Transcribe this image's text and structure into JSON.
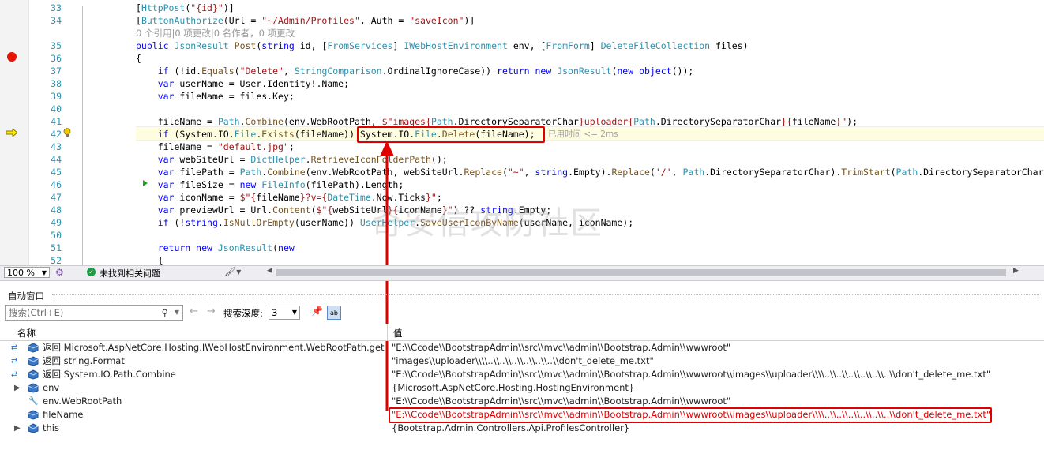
{
  "editor": {
    "lines": [
      {
        "n": "33",
        "parts": [
          [
            "p",
            "["
          ],
          [
            "at",
            "HttpPost"
          ],
          [
            "p",
            "("
          ],
          [
            "st",
            "\"{id}\""
          ],
          [
            "p",
            ")]"
          ]
        ]
      },
      {
        "n": "34",
        "parts": [
          [
            "p",
            "["
          ],
          [
            "at",
            "ButtonAuthorize"
          ],
          [
            "p",
            "(Url = "
          ],
          [
            "st",
            "\"~/Admin/Profiles\""
          ],
          [
            "p",
            ", Auth = "
          ],
          [
            "st",
            "\"saveIcon\""
          ],
          [
            "p",
            ")]"
          ]
        ]
      },
      {
        "n": "",
        "codelens": "0 个引用|0 项更改|0 名作者，0 项更改"
      },
      {
        "n": "35",
        "parts": [
          [
            "kw",
            "public "
          ],
          [
            "ty",
            "JsonResult "
          ],
          [
            "fn",
            "Post"
          ],
          [
            "p",
            "("
          ],
          [
            "kw",
            "string"
          ],
          [
            "p",
            " id, ["
          ],
          [
            "ty",
            "FromServices"
          ],
          [
            "p",
            "] "
          ],
          [
            "ty",
            "IWebHostEnvironment"
          ],
          [
            "p",
            " env, ["
          ],
          [
            "ty",
            "FromForm"
          ],
          [
            "p",
            "] "
          ],
          [
            "ty",
            "DeleteFileCollection"
          ],
          [
            "p",
            " files)"
          ]
        ]
      },
      {
        "n": "36",
        "parts": [
          [
            "p",
            "{"
          ]
        ]
      },
      {
        "n": "37",
        "parts": [
          [
            "kw",
            "    if "
          ],
          [
            "p",
            "(!id."
          ],
          [
            "fn",
            "Equals"
          ],
          [
            "p",
            "("
          ],
          [
            "st",
            "\"Delete\""
          ],
          [
            "p",
            ", "
          ],
          [
            "ty",
            "StringComparison"
          ],
          [
            "p",
            ".OrdinalIgnoreCase)) "
          ],
          [
            "kw",
            "return new "
          ],
          [
            "ty",
            "JsonResult"
          ],
          [
            "p",
            "("
          ],
          [
            "kw",
            "new object"
          ],
          [
            "p",
            "());"
          ]
        ]
      },
      {
        "n": "38",
        "parts": [
          [
            "kw",
            "    var "
          ],
          [
            "p",
            "userName = User.Identity!.Name;"
          ]
        ]
      },
      {
        "n": "39",
        "parts": [
          [
            "kw",
            "    var "
          ],
          [
            "p",
            "fileName = files.Key;"
          ]
        ]
      },
      {
        "n": "40",
        "parts": []
      },
      {
        "n": "41",
        "parts": [
          [
            "p",
            "    fileName = "
          ],
          [
            "ty",
            "Path"
          ],
          [
            "p",
            "."
          ],
          [
            "fn",
            "Combine"
          ],
          [
            "p",
            "(env.WebRootPath, "
          ],
          [
            "st",
            "$\"images{"
          ],
          [
            "ty",
            "Path"
          ],
          [
            "p",
            ".DirectorySeparatorChar"
          ],
          [
            "st",
            "}uploader{"
          ],
          [
            "ty",
            "Path"
          ],
          [
            "p",
            ".DirectorySeparatorChar"
          ],
          [
            "st",
            "}{"
          ],
          [
            "p",
            "fileName"
          ],
          [
            "st",
            "}\""
          ],
          [
            "p",
            ");"
          ]
        ]
      },
      {
        "n": "42",
        "parts": [
          [
            "kw",
            "    if "
          ],
          [
            "p",
            "(System.IO."
          ],
          [
            "ty",
            "File"
          ],
          [
            "p",
            "."
          ],
          [
            "fn",
            "Exists"
          ],
          [
            "p",
            "(fileName)) System.IO."
          ],
          [
            "ty",
            "File"
          ],
          [
            "p",
            "."
          ],
          [
            "fn",
            "Delete"
          ],
          [
            "p",
            "(fileName);"
          ]
        ]
      },
      {
        "n": "43",
        "parts": [
          [
            "p",
            "    fileName = "
          ],
          [
            "st",
            "\"default.jpg\""
          ],
          [
            "p",
            ";"
          ]
        ]
      },
      {
        "n": "44",
        "parts": [
          [
            "kw",
            "    var "
          ],
          [
            "p",
            "webSiteUrl = "
          ],
          [
            "ty",
            "DictHelper"
          ],
          [
            "p",
            "."
          ],
          [
            "fn",
            "RetrieveIconFolderPath"
          ],
          [
            "p",
            "();"
          ]
        ]
      },
      {
        "n": "45",
        "parts": [
          [
            "kw",
            "    var "
          ],
          [
            "p",
            "filePath = "
          ],
          [
            "ty",
            "Path"
          ],
          [
            "p",
            "."
          ],
          [
            "fn",
            "Combine"
          ],
          [
            "p",
            "(env.WebRootPath, webSiteUrl."
          ],
          [
            "fn",
            "Replace"
          ],
          [
            "p",
            "("
          ],
          [
            "st",
            "\"~\""
          ],
          [
            "p",
            ", "
          ],
          [
            "kw",
            "string"
          ],
          [
            "p",
            ".Empty)."
          ],
          [
            "fn",
            "Replace"
          ],
          [
            "p",
            "("
          ],
          [
            "st",
            "'/'"
          ],
          [
            "p",
            ", "
          ],
          [
            "ty",
            "Path"
          ],
          [
            "p",
            ".DirectorySeparatorChar)."
          ],
          [
            "fn",
            "TrimStart"
          ],
          [
            "p",
            "("
          ],
          [
            "ty",
            "Path"
          ],
          [
            "p",
            ".DirectorySeparatorChar"
          ]
        ]
      },
      {
        "n": "46",
        "parts": [
          [
            "kw",
            "    var "
          ],
          [
            "p",
            "fileSize = "
          ],
          [
            "kw",
            "new "
          ],
          [
            "ty",
            "FileInfo"
          ],
          [
            "p",
            "(filePath).Length;"
          ]
        ]
      },
      {
        "n": "47",
        "parts": [
          [
            "kw",
            "    var "
          ],
          [
            "p",
            "iconName = "
          ],
          [
            "st",
            "$\"{"
          ],
          [
            "p",
            "fileName"
          ],
          [
            "st",
            "}?v={"
          ],
          [
            "ty",
            "DateTime"
          ],
          [
            "p",
            ".Now.Ticks"
          ],
          [
            "st",
            "}\""
          ],
          [
            "p",
            ";"
          ]
        ]
      },
      {
        "n": "48",
        "parts": [
          [
            "kw",
            "    var "
          ],
          [
            "p",
            "previewUrl = Url."
          ],
          [
            "fn",
            "Content"
          ],
          [
            "p",
            "("
          ],
          [
            "st",
            "$\"{"
          ],
          [
            "p",
            "webSiteUrl"
          ],
          [
            "st",
            "}{"
          ],
          [
            "p",
            "iconName"
          ],
          [
            "st",
            "}\""
          ],
          [
            "p",
            ") ?? "
          ],
          [
            "kw",
            "string"
          ],
          [
            "p",
            ".Empty;"
          ]
        ]
      },
      {
        "n": "49",
        "parts": [
          [
            "kw",
            "    if "
          ],
          [
            "p",
            "(!"
          ],
          [
            "kw",
            "string"
          ],
          [
            "p",
            "."
          ],
          [
            "fn",
            "IsNullOrEmpty"
          ],
          [
            "p",
            "(userName)) "
          ],
          [
            "ty",
            "UserHelper"
          ],
          [
            "p",
            "."
          ],
          [
            "fn",
            "SaveUserIconByName"
          ],
          [
            "p",
            "(userName, iconName);"
          ]
        ]
      },
      {
        "n": "50",
        "parts": []
      },
      {
        "n": "51",
        "parts": [
          [
            "kw",
            "    return new "
          ],
          [
            "ty",
            "JsonResult"
          ],
          [
            "p",
            "("
          ],
          [
            "kw",
            "new"
          ]
        ]
      },
      {
        "n": "52",
        "parts": [
          [
            "p",
            "    {"
          ]
        ]
      }
    ],
    "elapsed_hint": "已用时间 <= 2ms",
    "watermark": "奇安信攻防社区"
  },
  "statusstrip": {
    "zoom": "100 %",
    "issues": "未找到相关问题"
  },
  "autos": {
    "title": "自动窗口",
    "search_placeholder": "搜索(Ctrl+E)",
    "depth_label": "搜索深度:",
    "depth_value": "3",
    "col_name": "名称",
    "col_value": "值",
    "rows": [
      {
        "kind": "ret",
        "name": "返回 Microsoft.AspNetCore.Hosting.IWebHostEnvironment.WebRootPath.get",
        "value": "\"E:\\\\Ccode\\\\BootstrapAdmin\\\\src\\\\mvc\\\\admin\\\\Bootstrap.Admin\\\\wwwroot\""
      },
      {
        "kind": "ret",
        "name": "返回 string.Format",
        "value": "\"images\\\\uploader\\\\\\\\..\\\\..\\\\..\\\\..\\\\..\\\\..\\\\don't_delete_me.txt\""
      },
      {
        "kind": "ret",
        "name": "返回 System.IO.Path.Combine",
        "value": "\"E:\\\\Ccode\\\\BootstrapAdmin\\\\src\\\\mvc\\\\admin\\\\Bootstrap.Admin\\\\wwwroot\\\\images\\\\uploader\\\\\\\\..\\\\..\\\\..\\\\..\\\\..\\\\..\\\\don't_delete_me.txt\""
      },
      {
        "kind": "exp",
        "name": "env",
        "value": "{Microsoft.AspNetCore.Hosting.HostingEnvironment}"
      },
      {
        "kind": "wrench",
        "name": "env.WebRootPath",
        "value": "\"E:\\\\Ccode\\\\BootstrapAdmin\\\\src\\\\mvc\\\\admin\\\\Bootstrap.Admin\\\\wwwroot\""
      },
      {
        "kind": "plain",
        "name": "fileName",
        "value": "\"E:\\\\Ccode\\\\BootstrapAdmin\\\\src\\\\mvc\\\\admin\\\\Bootstrap.Admin\\\\wwwroot\\\\images\\\\uploader\\\\\\\\..\\\\..\\\\..\\\\..\\\\..\\\\..\\\\don't_delete_me.txt\"",
        "highlight": true,
        "value_color": "#e00000"
      },
      {
        "kind": "exp",
        "name": "this",
        "value": "{Bootstrap.Admin.Controllers.Api.ProfilesController}"
      }
    ]
  },
  "colors": {
    "highlight_red": "#e00000",
    "line_number": "#2b91af",
    "keyword": "#0000ff",
    "type": "#2b91af",
    "string": "#a31515",
    "breakpoint": "#e51400"
  }
}
